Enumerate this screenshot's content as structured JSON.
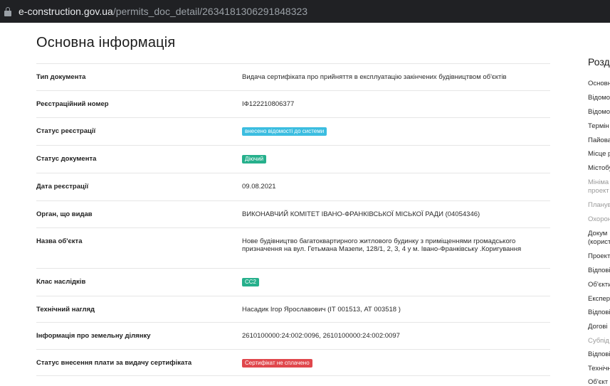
{
  "browser": {
    "url_domain": "e-construction.gov.ua",
    "url_path": "/permits_doc_detail/2634181306291848323"
  },
  "main": {
    "title": "Основна інформація",
    "rows": [
      {
        "label": "Тип документа",
        "value": "Видача сертифіката про прийняття в експлуатацію закінчених будівництвом об'єктів"
      },
      {
        "label": "Реєстраційний номер",
        "value": "ІФ122210806377"
      },
      {
        "label": "Статус реєстрації",
        "badge": "внесено відомості до системи",
        "badge_color": "#3bbde0"
      },
      {
        "label": "Статус документа",
        "badge": "Діючий",
        "badge_color": "#26b08c"
      },
      {
        "label": "Дата реєстрації",
        "value": "09.08.2021"
      },
      {
        "label": "Орган, що видав",
        "value": "ВИКОНАВЧИЙ КОМІТЕТ ІВАНО-ФРАНКІВСЬКОЇ МІСЬКОЇ РАДИ (04054346)"
      },
      {
        "label": "Назва об'єкта",
        "value": "Нове будівництво багатоквартирного житлового будинку з приміщеннями громадського призначення на вул. Гетьмана Мазепи, 128/1, 2, 3, 4 у м. Івано-Франківську .Коригування"
      },
      {
        "label": "Клас наслідків",
        "badge": "СС2",
        "badge_color": "#26b08c"
      },
      {
        "label": "Технічний нагляд",
        "value": "Насадик Ігор Ярославович (ІТ 001513, АТ 003518 )"
      },
      {
        "label": "Інформація про земельну ділянку",
        "value": "2610100000:24:002:0096, 2610100000:24:002:0097"
      },
      {
        "label": "Статус внесення плати за видачу сертифіката",
        "badge": "Сертифікат не сплачено",
        "badge_color": "#e0474c"
      }
    ]
  },
  "sidebar": {
    "heading": "Розд",
    "items": [
      {
        "label": "Основн",
        "muted": false
      },
      {
        "label": "Відомо",
        "muted": false
      },
      {
        "label": "Відомо",
        "muted": false
      },
      {
        "label": "Термін",
        "muted": false
      },
      {
        "label": "Пайова",
        "muted": false
      },
      {
        "label": "Місце р",
        "muted": false
      },
      {
        "label": "Містобу",
        "muted": false
      },
      {
        "label": "Мініма",
        "muted": true
      },
      {
        "label": "проект",
        "muted": true
      },
      {
        "label": "Планув",
        "muted": true
      },
      {
        "label": "Охорон",
        "muted": true
      },
      {
        "label": "Докум",
        "muted": false
      },
      {
        "label": "(корист",
        "muted": false
      },
      {
        "label": "Проект",
        "muted": false
      },
      {
        "label": "Відпові",
        "muted": false
      },
      {
        "label": "Об'єкти",
        "muted": false
      },
      {
        "label": "Експер",
        "muted": false
      },
      {
        "label": "Відпові",
        "muted": false
      },
      {
        "label": "Догові",
        "muted": false
      },
      {
        "label": "Субпід",
        "muted": true
      },
      {
        "label": "Відпові",
        "muted": false
      },
      {
        "label": "Технічн",
        "muted": false
      },
      {
        "label": "Об'єкт",
        "muted": false
      }
    ]
  },
  "colors": {
    "text_muted": "#9a9a9a",
    "text": "#2a2a2a"
  }
}
